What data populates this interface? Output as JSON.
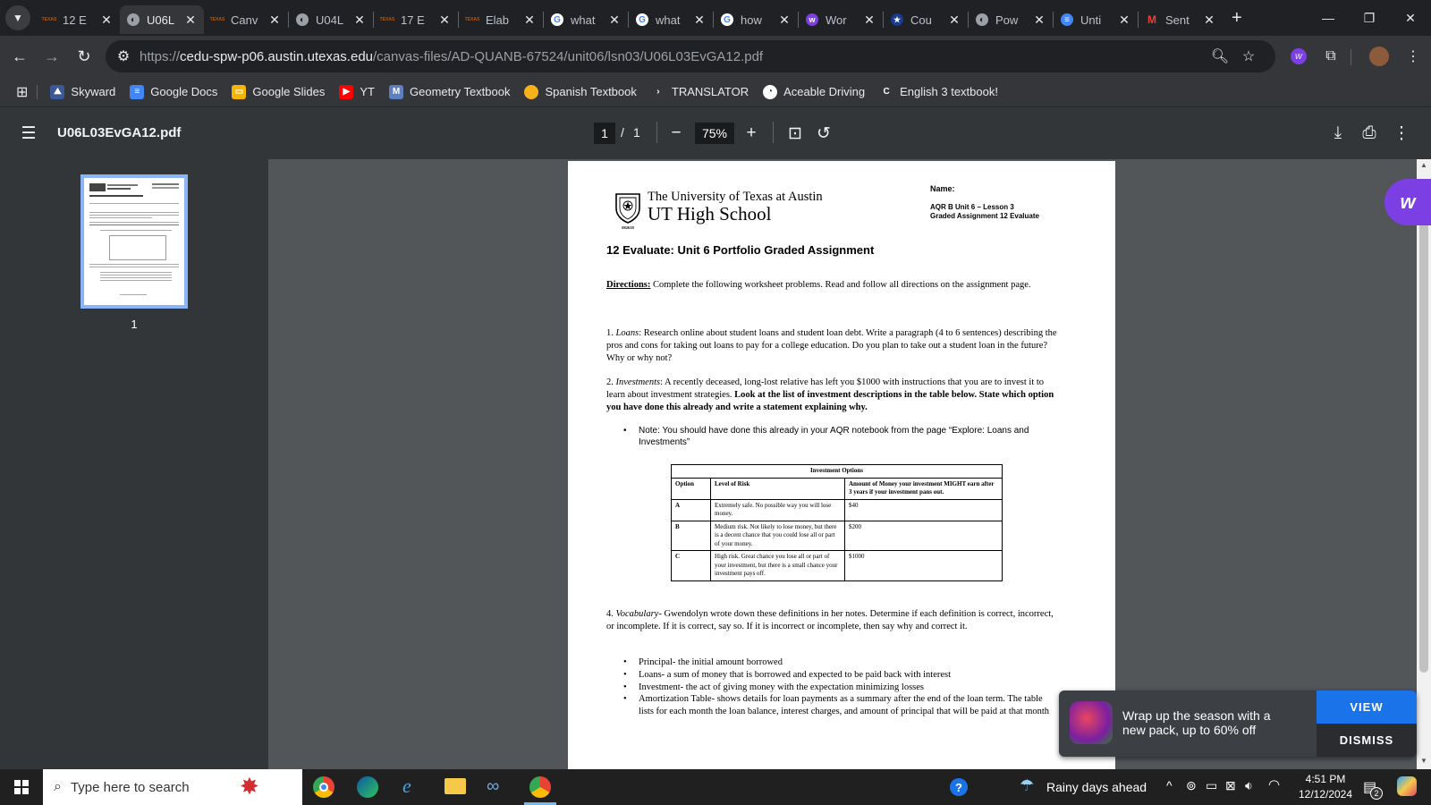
{
  "tabs": [
    {
      "title": "12 E",
      "icon": "texas-icon",
      "active": false
    },
    {
      "title": "U06L",
      "icon": "globe-icon",
      "active": true
    },
    {
      "title": "Canv",
      "icon": "texas-icon",
      "active": false
    },
    {
      "title": "U04L",
      "icon": "globe-icon",
      "active": false
    },
    {
      "title": "17 E",
      "icon": "texas-icon",
      "active": false
    },
    {
      "title": "Elab",
      "icon": "texas-icon",
      "active": false
    },
    {
      "title": "what",
      "icon": "google-icon",
      "active": false
    },
    {
      "title": "what",
      "icon": "google-icon",
      "active": false
    },
    {
      "title": "how",
      "icon": "google-icon",
      "active": false
    },
    {
      "title": "Wor",
      "icon": "wordtune-icon",
      "active": false
    },
    {
      "title": "Cou",
      "icon": "star-icon",
      "active": false
    },
    {
      "title": "Pow",
      "icon": "globe-icon",
      "active": false
    },
    {
      "title": "Unti",
      "icon": "docs-icon",
      "active": false
    },
    {
      "title": "Sent",
      "icon": "gmail-icon",
      "active": false
    }
  ],
  "address": {
    "scheme": "https://",
    "host": "cedu-spw-p06.austin.utexas.edu",
    "path": "/canvas-files/AD-QUANB-67524/unit06/lsn03/U06L03EvGA12.pdf"
  },
  "bookmarks": [
    {
      "label": "Skyward",
      "icon": "skyward-icon",
      "color": "#3b5998"
    },
    {
      "label": "Google Docs",
      "icon": "docs-icon",
      "color": "#4285f4"
    },
    {
      "label": "Google Slides",
      "icon": "slides-icon",
      "color": "#f4b400"
    },
    {
      "label": "YT",
      "icon": "youtube-icon",
      "color": "#ff0000"
    },
    {
      "label": "Geometry Textbook",
      "icon": "m-icon",
      "color": "#5b7fbf"
    },
    {
      "label": "Spanish Textbook",
      "icon": "circle-icon",
      "color": "#f6b21b"
    },
    {
      "label": "TRANSLATOR",
      "icon": "chevron-right-icon",
      "color": "#35363a"
    },
    {
      "label": "Aceable Driving",
      "icon": "aceable-icon",
      "color": "#ffffff"
    },
    {
      "label": "English 3 textbook!",
      "icon": "cl-icon",
      "color": "#35363a"
    }
  ],
  "pdf_toolbar": {
    "filename": "U06L03EvGA12.pdf",
    "current_page": "1",
    "page_sep": "/",
    "total_pages": "1",
    "zoom": "75%"
  },
  "thumbnail": {
    "number": "1"
  },
  "document": {
    "univ_line1": "The University of Texas at Austin",
    "univ_line2": "UT High School",
    "seal_text": "082618",
    "name_label": "Name:",
    "course_line1": "AQR B Unit 6 – Lesson 3",
    "course_line2": "Graded Assignment 12 Evaluate",
    "title": "12 Evaluate: Unit 6 Portfolio Graded Assignment",
    "directions_label": "Directions:",
    "directions_text": " Complete the following worksheet problems. Read and follow all directions on the assignment page.",
    "q1_num": "1. ",
    "q1_term": "Loans",
    "q1_text": ": Research online about student loans and student loan debt. Write a paragraph (4 to 6 sentences) describing the pros and cons for taking out loans to pay for a college education. Do you plan to take out a student loan in the future? Why or why not?",
    "q2_num": "2. ",
    "q2_term": "Investments",
    "q2_text": ": A recently deceased, long-lost relative has left you $1000 with instructions that you are to invest it to learn about investment strategies. ",
    "q2_bold": "Look at the list of investment descriptions in the table below. State which option you have done this already and write a statement explaining why.",
    "note": "Note: You should have done this already in your AQR notebook from the page “Explore: Loans and Investments”",
    "table": {
      "caption": "Investment Options",
      "headers": [
        "Option",
        "Level of Risk",
        "Amount of Money your investment MIGHT earn after 3 years if your investment pans out."
      ],
      "rows": [
        [
          "A",
          "Extremely safe. No possible way you will lose money.",
          "$40"
        ],
        [
          "B",
          "Medium risk. Not likely to lose money, but there is a decent chance that you could lose all or part of your money.",
          "$200"
        ],
        [
          "C",
          "High risk. Great chance you lose all or part of your investment, but there is a small chance your investment pays off.",
          "$1000"
        ]
      ]
    },
    "q4_num": "4. ",
    "q4_term": "Vocabulary",
    "q4_text": "- Gwendolyn wrote down these definitions in her notes. Determine if each definition is correct, incorrect, or incomplete. If it is correct, say so. If it is incorrect or incomplete, then say why and correct it.",
    "vocab": [
      "Principal- the initial amount borrowed",
      "Loans- a sum of money that is borrowed and expected to be paid back with interest",
      "Investment- the act of giving money with the expectation minimizing losses",
      "Amortization Table- shows details for loan payments as a summary after the end of the loan term. The table lists for each month the loan balance, interest charges, and amount of principal that will be paid at that month"
    ]
  },
  "promo": {
    "text": "Wrap up the season with a new pack, up to 60% off",
    "view_label": "VIEW",
    "dismiss_label": "DISMISS"
  },
  "taskbar": {
    "search_placeholder": "Type here to search",
    "weather": "Rainy days ahead",
    "time": "4:51 PM",
    "date": "12/12/2024",
    "notif_count": "2"
  },
  "colors": {
    "accent": "#8ab4f8",
    "promo_view": "#1a73e8",
    "extension_purple": "#7b3fe4"
  }
}
